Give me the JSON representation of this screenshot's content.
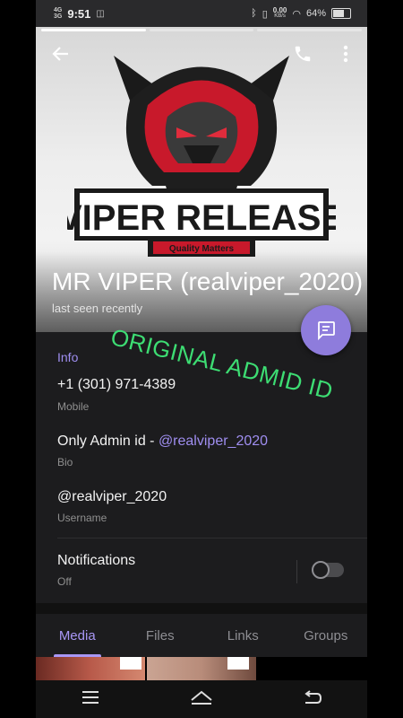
{
  "status_bar": {
    "network_1": "4G",
    "network_2": "3G",
    "time": "9:51",
    "speed_value": "0.00",
    "speed_unit": "KB/s",
    "battery": "64%"
  },
  "profile": {
    "name": "MR VIPER (realviper_2020)",
    "last_seen": "last seen recently",
    "logo_text": "VIPER RELEASE",
    "logo_tagline": "Quality Matters"
  },
  "overlay_text": "ORIGINAL ADMID ID",
  "info": {
    "title": "Info",
    "phone": "+1 (301) 971-4389",
    "phone_label": "Mobile",
    "bio_prefix": "Only Admin id - ",
    "bio_link": "@realviper_2020",
    "bio_label": "Bio",
    "username": "@realviper_2020",
    "username_label": "Username"
  },
  "notifications": {
    "label": "Notifications",
    "state": "Off"
  },
  "tabs": [
    "Media",
    "Files",
    "Links",
    "Groups"
  ],
  "colors": {
    "accent": "#9f8ef0",
    "fab": "#8e7cdc",
    "watermark": "#3ddd73",
    "background": "#1c1c1e"
  },
  "icons": [
    "back-arrow-icon",
    "phone-icon",
    "more-vert-icon",
    "message-icon",
    "home-icon",
    "menu-icon",
    "return-icon"
  ]
}
